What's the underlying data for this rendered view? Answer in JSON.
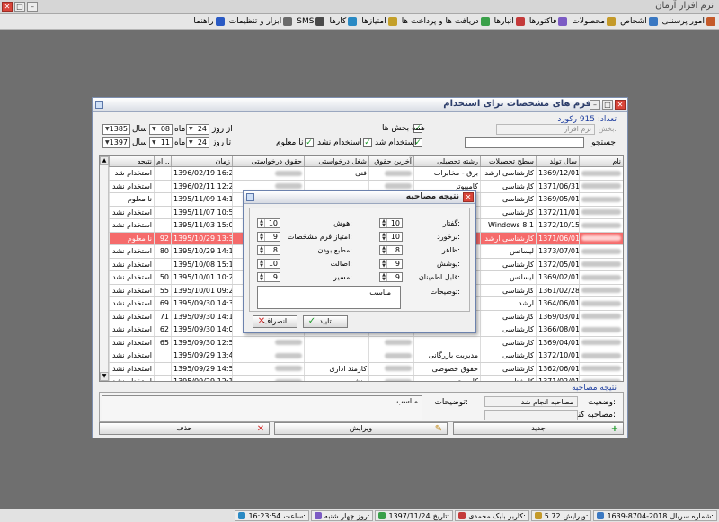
{
  "app": {
    "title": "نرم افزار آرمان"
  },
  "menu": [
    {
      "label": "امور پرسنلی",
      "icon": "personnel-icon",
      "color": "#c45a2a"
    },
    {
      "label": "اشخاص",
      "icon": "people-icon",
      "color": "#3a78c2"
    },
    {
      "label": "محصولات",
      "icon": "products-icon",
      "color": "#c49a2a"
    },
    {
      "label": "فاکتورها",
      "icon": "invoice-icon",
      "color": "#7c5bc4"
    },
    {
      "label": "انبارها",
      "icon": "warehouse-icon",
      "color": "#c43a3a"
    },
    {
      "label": "دریافت ها و پرداخت ها",
      "icon": "payments-icon",
      "color": "#3aa04a"
    },
    {
      "label": "امتیازها",
      "icon": "score-icon",
      "color": "#c4a02a"
    },
    {
      "label": "کارها",
      "icon": "tasks-icon",
      "color": "#2a8ac4"
    },
    {
      "label": "SMS",
      "icon": "sms-icon",
      "color": "#4a4a4a"
    },
    {
      "label": "ابزار و تنظیمات",
      "icon": "tools-icon",
      "color": "#6a6a6a"
    },
    {
      "label": "راهنما",
      "icon": "help-icon",
      "color": "#2a5ac4"
    }
  ],
  "window": {
    "title": "فرم های مشخصات برای استخدام",
    "count_label": "تعداد:",
    "count_value": "915 رکورد",
    "filter": {
      "section_label": "بخش:",
      "section_value": "نرم افزار",
      "all_sections_label": "همه بخش ها",
      "search_label": "جستجو:",
      "hired_label": "استخدام شد",
      "not_hired_label": "استخدام نشد",
      "unknown_label": "نا معلوم",
      "from_label": "از روز",
      "to_label": "تا روز",
      "month_label": "ماه",
      "year_label": "سال",
      "from_day": "24",
      "from_month": "08",
      "from_year": "1385",
      "to_day": "24",
      "to_month": "11",
      "to_year": "1397"
    },
    "columns": [
      "نام",
      "سال تولد",
      "سطح تحصیلات",
      "رشته تحصیلی",
      "آخرین حقوق",
      "شغل درخواستی",
      "حقوق درخواستی",
      "زمان",
      "ام...",
      "نتیجه"
    ],
    "rows": [
      {
        "birth": "1369/12/01",
        "edu": "کارشناسی ارشد",
        "field": "برق - مخابرات",
        "job": "فنی",
        "time": "1396/02/19 16:22",
        "score": "",
        "result": "استخدام شد"
      },
      {
        "birth": "1371/06/31",
        "edu": "کارشناسی",
        "field": "کامپیوتر",
        "job": "",
        "time": "1396/02/11 12:23",
        "score": "",
        "result": "استخدام نشد"
      },
      {
        "birth": "1369/05/01",
        "edu": "کارشناسی",
        "field": "",
        "job": "",
        "time": "1395/11/09 14:12",
        "score": "",
        "result": "نا معلوم"
      },
      {
        "birth": "1372/11/01",
        "edu": "کارشناسی",
        "field": "",
        "job": "",
        "time": "1395/11/07 10:57",
        "score": "",
        "result": "استخدام نشد"
      },
      {
        "birth": "1372/10/15",
        "edu": "Windows 8.1",
        "field": "",
        "job": "",
        "time": "1395/11/03 15:05",
        "score": "",
        "result": "استخدام نشد"
      },
      {
        "birth": "1371/06/01",
        "edu": "کارشناسی ارشد",
        "field": "",
        "job": "",
        "time": "1395/10/29 13:38",
        "score": "92",
        "result": "نا معلوم"
      },
      {
        "birth": "1373/07/01",
        "edu": "لیسانس",
        "field": "",
        "job": "",
        "time": "1395/10/29 14:12",
        "score": "80",
        "result": "استخدام نشد"
      },
      {
        "birth": "1372/05/01",
        "edu": "کارشناسی",
        "field": "",
        "job": "",
        "time": "1395/10/08 15:10",
        "score": "",
        "result": "استخدام نشد"
      },
      {
        "birth": "1369/02/01",
        "edu": "لیسانس",
        "field": "",
        "job": "",
        "time": "1395/10/01 10:20",
        "score": "50",
        "result": "استخدام نشد"
      },
      {
        "birth": "1361/02/28",
        "edu": "کارشناسی",
        "field": "",
        "job": "",
        "time": "1395/10/01 09:22",
        "score": "55",
        "result": "استخدام نشد"
      },
      {
        "birth": "1364/06/01",
        "edu": "ارشد",
        "field": "",
        "job": "",
        "time": "1395/09/30 14:30",
        "score": "69",
        "result": "استخدام نشد"
      },
      {
        "birth": "1369/03/01",
        "edu": "کارشناسی",
        "field": "",
        "job": "",
        "time": "1395/09/30 14:12",
        "score": "71",
        "result": "استخدام نشد"
      },
      {
        "birth": "1366/08/01",
        "edu": "کارشناسی",
        "field": "",
        "job": "",
        "time": "1395/09/30 14:08",
        "score": "62",
        "result": "استخدام نشد"
      },
      {
        "birth": "1369/04/01",
        "edu": "کارشناسی",
        "field": "",
        "job": "",
        "time": "1395/09/30 12:53",
        "score": "65",
        "result": "استخدام نشد"
      },
      {
        "birth": "1372/10/01",
        "edu": "کارشناسی",
        "field": "مدیریت بازرگانی",
        "job": "",
        "time": "1395/09/29 13:42",
        "score": "",
        "result": "استخدام نشد"
      },
      {
        "birth": "1362/06/01",
        "edu": "کارشناسی",
        "field": "حقوق خصوصی",
        "job": "کارمند اداری",
        "time": "1395/09/29 14:58",
        "score": "",
        "result": "استخدام نشد"
      },
      {
        "birth": "1371/02/01",
        "edu": "کارشناسی",
        "field": "کامپیوتر",
        "job": "منشی",
        "time": "1395/09/29 12:14",
        "score": "",
        "result": "استخدام نشد"
      },
      {
        "birth": "1373/06/01",
        "edu": "کارشناسی",
        "field": "",
        "job": "",
        "time": "1395/09/29 10:58",
        "score": "",
        "result": "استخدام نشد"
      }
    ],
    "interview_section": "نتیجه مصاحبه",
    "status_label": "وضعیت:",
    "status_value": "مصاحبه انجام شد",
    "interviewer_label": "مصاحبه کننده:",
    "notes_label": "توضیحات:",
    "notes_value": "مناسب",
    "buttons": {
      "new": "جدید",
      "edit": "ویرایش",
      "delete": "حذف"
    }
  },
  "dialog": {
    "title": "نتیجه مصاحبه",
    "fields": {
      "speech_label": "گفتار:",
      "speech": "10",
      "intelligence_label": "هوش:",
      "intelligence": "10",
      "behavior_label": "برخورد:",
      "behavior": "10",
      "form_score_label": "امتیاز فرم مشخصات:",
      "form_score": "9",
      "appearance_label": "ظاهر:",
      "appearance": "8",
      "related_edu_label": "مطبع بودن:",
      "related_edu": "8",
      "clothing_label": "پوشش:",
      "clothing": "9",
      "originality_label": "اصالت:",
      "originality": "10",
      "trust_label": "قابل اطمینان:",
      "trust": "9",
      "path_label": "مسیر:",
      "path": "9",
      "desc_label": "توضیحات:",
      "desc": "مناسب"
    },
    "ok": "تایید",
    "cancel": "انصراف"
  },
  "statusbar": [
    {
      "label": "شماره سریال:",
      "value": "1639-8704-2018",
      "icon": "serial-icon"
    },
    {
      "label": "ویرایش:",
      "value": "5.72",
      "icon": "version-icon"
    },
    {
      "label": "کاربر:",
      "value": "بابک محمدی",
      "icon": "user-icon"
    },
    {
      "label": "تاریخ:",
      "value": "1397/11/24",
      "icon": "calendar-icon"
    },
    {
      "label": "روز:",
      "value": "چهار شنبه",
      "icon": "day-icon"
    },
    {
      "label": "ساعت:",
      "value": "16:23:54",
      "icon": "clock-icon"
    }
  ]
}
